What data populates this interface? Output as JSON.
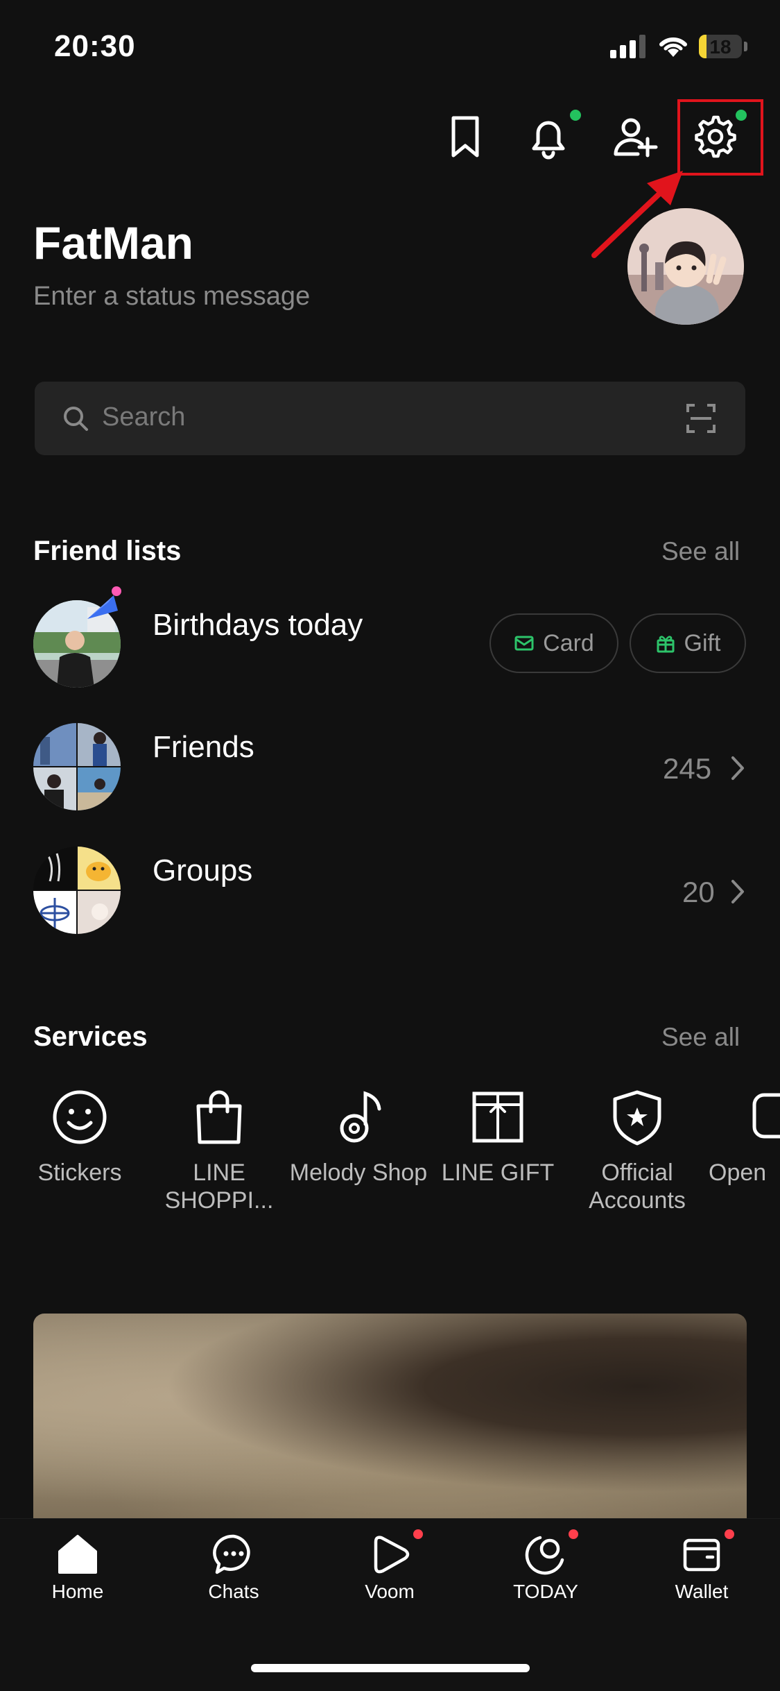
{
  "status_bar": {
    "time": "20:30",
    "battery": "18",
    "battery_level": 0.18
  },
  "top_actions": {
    "icons": [
      "bookmark-icon",
      "bell-icon",
      "add-friend-icon",
      "gear-icon"
    ],
    "badge_color": "#23c25e"
  },
  "profile": {
    "name": "FatMan",
    "status_placeholder": "Enter a status message"
  },
  "search": {
    "placeholder": "Search"
  },
  "friend_lists": {
    "title": "Friend lists",
    "see_all": "See all",
    "birthdays": {
      "label": "Birthdays today",
      "card_label": "Card",
      "gift_label": "Gift"
    },
    "friends": {
      "label": "Friends",
      "count": "245"
    },
    "groups": {
      "label": "Groups",
      "count": "20"
    }
  },
  "services": {
    "title": "Services",
    "see_all": "See all",
    "items": [
      {
        "label": "Stickers",
        "icon": "smiley-icon"
      },
      {
        "label": "LINE SHOPPI...",
        "icon": "shopping-bag-icon"
      },
      {
        "label": "Melody Shop",
        "icon": "music-note-icon"
      },
      {
        "label": "LINE GIFT",
        "icon": "gift-box-icon"
      },
      {
        "label": "Official Accounts",
        "icon": "shield-star-icon"
      },
      {
        "label": "Open",
        "icon": "open-chat-icon"
      }
    ]
  },
  "bottom_nav": {
    "items": [
      {
        "label": "Home",
        "icon": "home-icon"
      },
      {
        "label": "Chats",
        "icon": "chat-bubble-icon"
      },
      {
        "label": "Voom",
        "icon": "voom-play-icon"
      },
      {
        "label": "TODAY",
        "icon": "today-icon"
      },
      {
        "label": "Wallet",
        "icon": "wallet-icon"
      }
    ],
    "badge_color": "#ff3f4c"
  },
  "annotation": {
    "highlight_color": "#e1141c"
  }
}
